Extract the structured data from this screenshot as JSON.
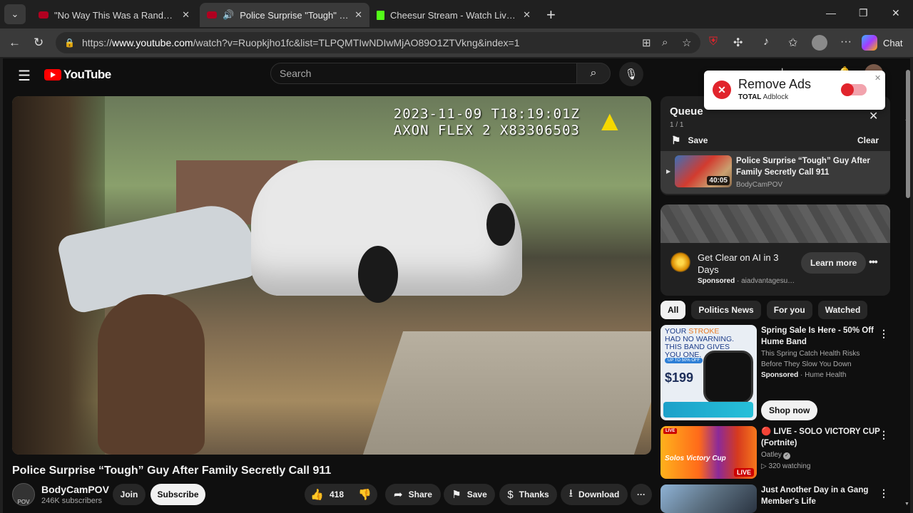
{
  "browser": {
    "tabs": [
      {
        "title": "\"No Way This Was a Random Traffi",
        "favicon_color": "#ff0000"
      },
      {
        "title": "Police Surprise \"Tough\" Guy A",
        "favicon_color": "#ff0000",
        "active": true
      },
      {
        "title": "Cheesur Stream - Watch Live on K",
        "favicon_color": "#53fc18"
      }
    ],
    "url_prefix": "https://",
    "url_domain": "www.youtube.com",
    "url_path": "/watch?v=Ruopkjho1fc&list=TLPQMTIwNDIwMjAO89O1ZTVkng&index=1",
    "chat_label": "Chat"
  },
  "youtube": {
    "logo_text": "YouTube",
    "search_placeholder": "Search",
    "video": {
      "overlay_timestamp": "2023-11-09 T18:19:01Z",
      "overlay_device": "AXON FLEX 2 X83306503",
      "title": "Police Surprise “Tough” Guy After Family Secretly Call 911",
      "channel": "BodyCamPOV",
      "avatar_text": "POV",
      "subscribers": "246K subscribers",
      "join_label": "Join",
      "subscribe_label": "Subscribe",
      "likes": "418",
      "share_label": "Share",
      "save_label": "Save",
      "thanks_label": "Thanks",
      "download_label": "Download"
    },
    "queue": {
      "title": "Queue",
      "count": "1 / 1",
      "save_label": "Save",
      "clear_label": "Clear",
      "item": {
        "title": "Police Surprise “Tough” Guy After Family Secretly Call 911",
        "duration": "40:05",
        "channel": "BodyCamPOV"
      }
    },
    "ad": {
      "title": "Get Clear on AI in 3 Days",
      "sponsored_label": "Sponsored",
      "advertiser": "aiadvantagesu…",
      "cta": "Learn more"
    },
    "chips": [
      "All",
      "Politics News",
      "For you",
      "Watched"
    ],
    "recommendations": [
      {
        "title": "Spring Sale Is Here - 50% Off Hume Band",
        "desc": "This Spring Catch Health Risks Before They Slow You Down",
        "sponsored_label": "Sponsored",
        "advertiser": "Hume Health",
        "cta": "Shop now",
        "thumb_line1": "YOUR",
        "thumb_line1b": "STROKE",
        "thumb_line2": "HAD NO WARNING.",
        "thumb_line3": "THIS BAND GIVES",
        "thumb_line4": "YOU ONE.",
        "thumb_tag": "UP TO 50% OFF",
        "thumb_price": "$199"
      },
      {
        "title": "🔴 LIVE - SOLO VICTORY CUP (Fortnite)",
        "channel": "Oatley",
        "watching": "320 watching",
        "thumb_live": "LIVE",
        "thumb_text": "Solos Victory Cup"
      },
      {
        "title": "Just Another Day in a Gang Member's Life"
      }
    ],
    "adblock": {
      "title": "Remove Ads",
      "brand_bold": "TOTAL",
      "brand_rest": "Adblock"
    }
  }
}
